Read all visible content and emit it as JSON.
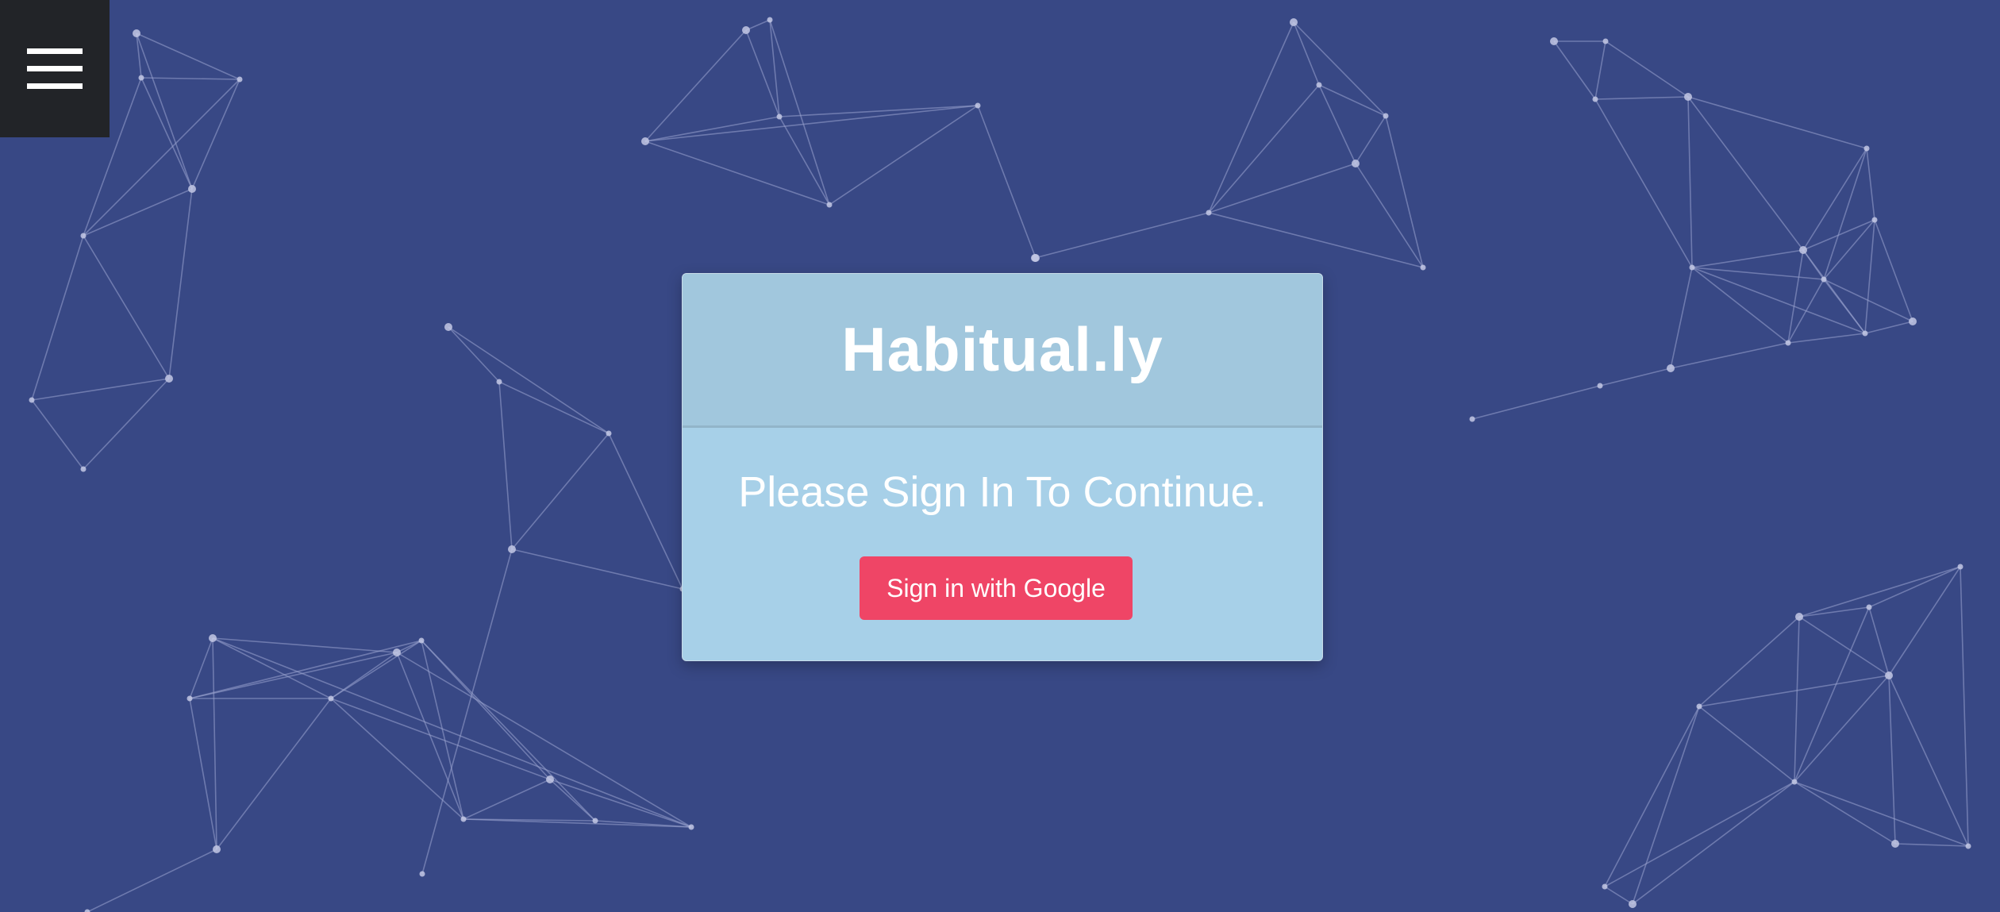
{
  "app": {
    "title": "Habitual.ly"
  },
  "menu": {
    "icon": "hamburger-menu-icon"
  },
  "signin": {
    "message": "Please Sign In To Continue.",
    "google_button_label": "Sign in with Google"
  },
  "colors": {
    "background": "#384885",
    "menu_background": "#222428",
    "card_header": "#a1c7dd",
    "card_body": "#a7d0e8",
    "google_button": "#ef4566",
    "network_lines": "#9aa4cf",
    "network_nodes": "#c3c8e4"
  }
}
